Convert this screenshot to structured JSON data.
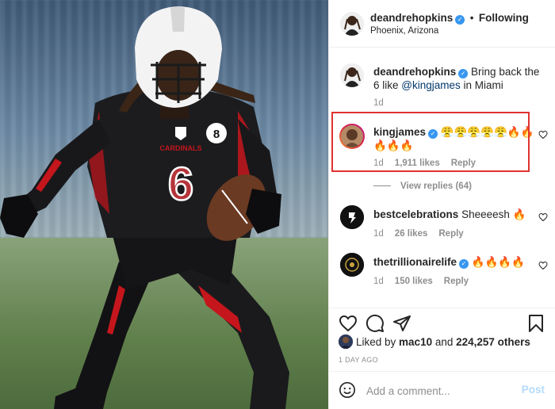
{
  "post": {
    "author": "deandrehopkins",
    "follow_label": "Following",
    "location": "Phoenix, Arizona",
    "jersey_number": "6",
    "helmet_number": "8",
    "team_wordmark": "CARDINALS"
  },
  "caption": {
    "username": "deandrehopkins",
    "text_before": "Bring back the 6 like ",
    "mention": "@kingjames",
    "text_after": " in Miami",
    "time": "1d"
  },
  "comments": [
    {
      "username": "kingjames",
      "verified": true,
      "text": "😤😤😤😤😤🔥🔥🔥🔥🔥",
      "time": "1d",
      "likes": "1,911 likes",
      "reply_label": "Reply",
      "highlighted": true
    },
    {
      "username": "bestcelebrations",
      "verified": false,
      "text": "Sheeeesh 🔥",
      "time": "1d",
      "likes": "26 likes",
      "reply_label": "Reply"
    },
    {
      "username": "thetrillionairelife",
      "verified": true,
      "text": "🔥🔥🔥🔥",
      "time": "1d",
      "likes": "150 likes",
      "reply_label": "Reply"
    }
  ],
  "view_replies": "View replies (64)",
  "likes": {
    "prefix": "Liked by ",
    "user": "mac10",
    "middle": " and ",
    "count": "224,257 others"
  },
  "time_ago": "1 DAY AGO",
  "composer": {
    "placeholder": "Add a comment...",
    "post_label": "Post"
  },
  "icons": {
    "heart": "heart-icon",
    "comment": "comment-icon",
    "share": "paper-plane-icon",
    "save": "bookmark-icon",
    "emoji": "smiley-icon",
    "verified": "verified-badge-icon"
  },
  "colors": {
    "verified": "#3897f0",
    "highlight_border": "#e0332f",
    "muted_text": "#8e8e8e",
    "post_button_disabled": "#b3dbff",
    "mention": "#00376b"
  }
}
